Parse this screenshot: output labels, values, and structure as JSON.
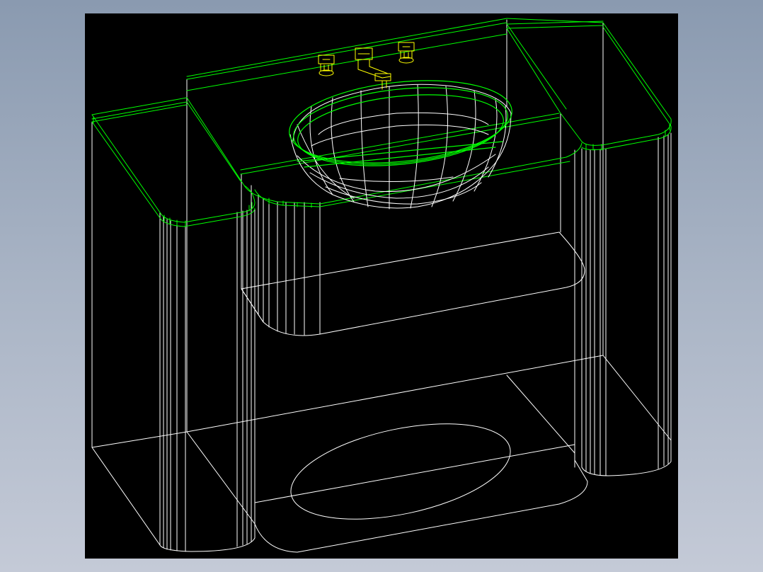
{
  "viewport": {
    "background": "#000000",
    "frame_background_gradient": [
      "#8a9ab0",
      "#c4cad7"
    ]
  },
  "layers": {
    "cabinet": {
      "color": "#ffffff",
      "description_name": "vanity-cabinet-wireframe"
    },
    "countertop": {
      "color": "#00ff00",
      "description_name": "countertop-wireframe"
    },
    "basin": {
      "color": "#ffffff",
      "rim_color": "#00ff00"
    },
    "faucet": {
      "color": "#ffff00"
    }
  }
}
